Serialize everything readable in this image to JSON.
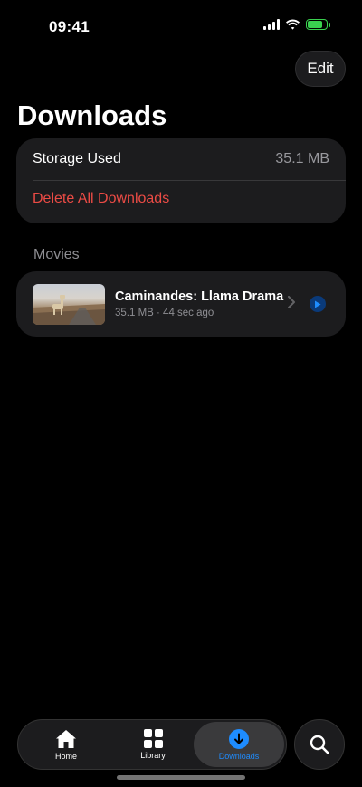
{
  "status_bar": {
    "time": "09:41",
    "icons": [
      "signal-icon",
      "wifi-icon",
      "battery-charging-icon"
    ],
    "battery_color": "#3ad14f"
  },
  "header": {
    "edit_label": "Edit",
    "title": "Downloads"
  },
  "storage": {
    "label": "Storage Used",
    "value": "35.1 MB",
    "delete_label": "Delete All Downloads",
    "delete_color": "#eb4b45"
  },
  "section": {
    "label": "Movies"
  },
  "movie": {
    "title": "Caminandes: Llama Drama",
    "meta": "35.1 MB · 44 sec ago",
    "icons": [
      "chevron-right-icon",
      "play-icon"
    ]
  },
  "tabbar": {
    "tabs": [
      {
        "label": "Home",
        "icon": "home-icon"
      },
      {
        "label": "Library",
        "icon": "grid-icon"
      },
      {
        "label": "Downloads",
        "icon": "download-icon",
        "active": true
      }
    ],
    "accent": "#1e8cff",
    "search_icon": "search-icon"
  }
}
